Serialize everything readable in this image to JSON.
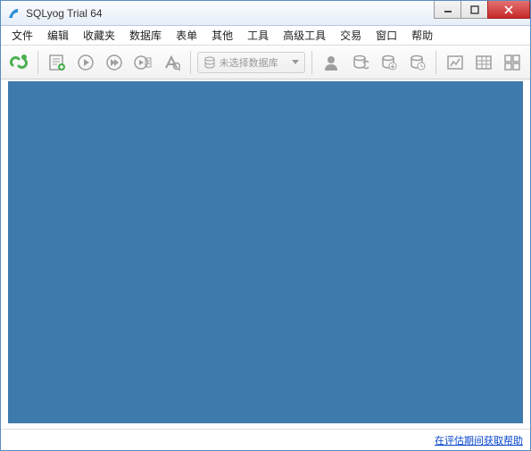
{
  "window": {
    "title": "SQLyog Trial 64"
  },
  "menu": {
    "items": [
      "文件",
      "编辑",
      "收藏夹",
      "数据库",
      "表单",
      "其他",
      "工具",
      "高级工具",
      "交易",
      "窗口",
      "帮助"
    ]
  },
  "toolbar": {
    "db_select_placeholder": "未选择数据库"
  },
  "status": {
    "trial_help_link": "在评估期间获取帮助"
  }
}
